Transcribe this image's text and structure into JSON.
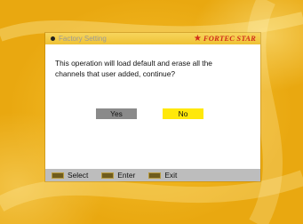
{
  "dialog": {
    "title": "Factory Setting",
    "brand": "FORTEC STAR",
    "brand_star_icon": "star-icon",
    "message_line1": "This operation will load default and erase all the",
    "message_line2": "channels that user added, continue?"
  },
  "buttons": {
    "yes_label": "Yes",
    "no_label": "No",
    "focused": "No"
  },
  "helpbar": {
    "items": [
      {
        "icon": "select-key-icon",
        "label": "Select"
      },
      {
        "icon": "enter-key-icon",
        "label": "Enter"
      },
      {
        "icon": "exit-key-icon",
        "label": "Exit"
      }
    ]
  },
  "colors": {
    "background": "#f2b81c",
    "titlebar": "#efc236",
    "brand": "#d12b1b",
    "yes_button": "#8a8a8a",
    "no_button_focused": "#ffe80a",
    "helpbar": "#bdbdbd"
  }
}
